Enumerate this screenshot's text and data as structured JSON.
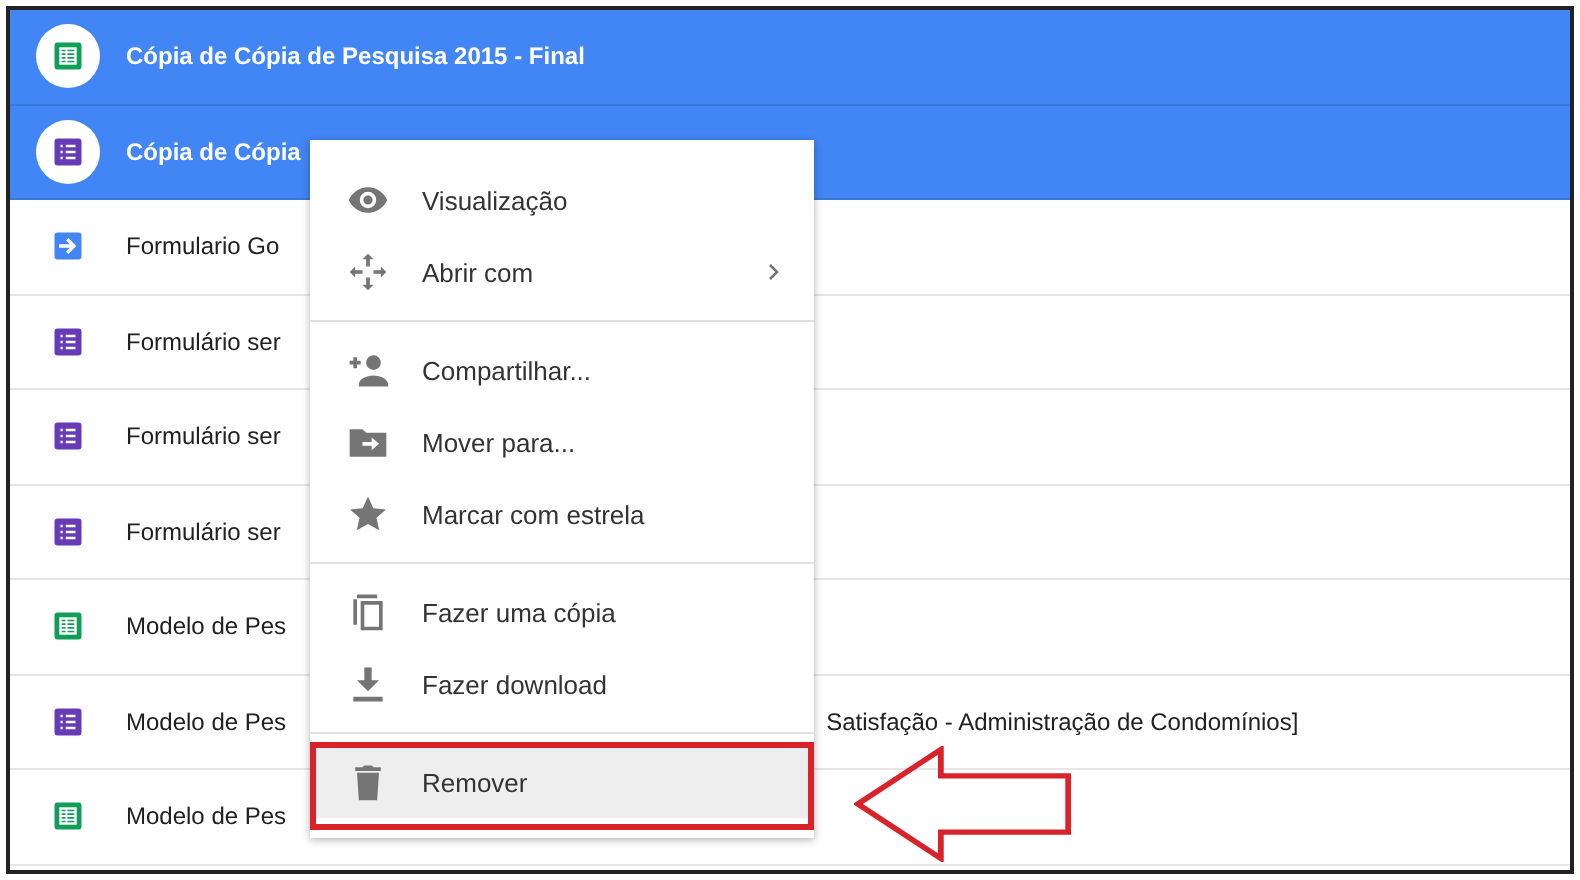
{
  "files": [
    {
      "kind": "sheet",
      "name": "Cópia de Cópia de Pesquisa 2015 - Final",
      "selected": true
    },
    {
      "kind": "form",
      "name": "Cópia de Cópia",
      "selected": true
    },
    {
      "kind": "shortcut",
      "name": "Formulario Go",
      "selected": false
    },
    {
      "kind": "form",
      "name": "Formulário ser",
      "selected": false
    },
    {
      "kind": "form",
      "name": "Formulário ser",
      "selected": false
    },
    {
      "kind": "form",
      "name": "Formulário ser",
      "selected": false
    },
    {
      "kind": "sheet",
      "name": "Modelo de Pes",
      "selected": false
    },
    {
      "kind": "form",
      "name": "Modelo de Pes",
      "name_end": "Satisfação - Administração de Condomínios]",
      "selected": false
    },
    {
      "kind": "sheet",
      "name": "Modelo de Pes",
      "selected": false
    }
  ],
  "context_menu": {
    "groups": [
      [
        {
          "kind": "preview",
          "label": "Visualização",
          "submenu": false,
          "selected": false
        },
        {
          "kind": "open",
          "label": "Abrir com",
          "submenu": true,
          "selected": false
        }
      ],
      [
        {
          "kind": "share",
          "label": "Compartilhar...",
          "submenu": false,
          "selected": false
        },
        {
          "kind": "move",
          "label": "Mover para...",
          "submenu": false,
          "selected": false
        },
        {
          "kind": "star",
          "label": "Marcar com estrela",
          "submenu": false,
          "selected": false
        }
      ],
      [
        {
          "kind": "copy",
          "label": "Fazer uma cópia",
          "submenu": false,
          "selected": false
        },
        {
          "kind": "download",
          "label": "Fazer download",
          "submenu": false,
          "selected": false
        }
      ],
      [
        {
          "kind": "remove",
          "label": "Remover",
          "submenu": false,
          "selected": true
        }
      ]
    ]
  },
  "callout": {
    "kind": "arrow"
  }
}
